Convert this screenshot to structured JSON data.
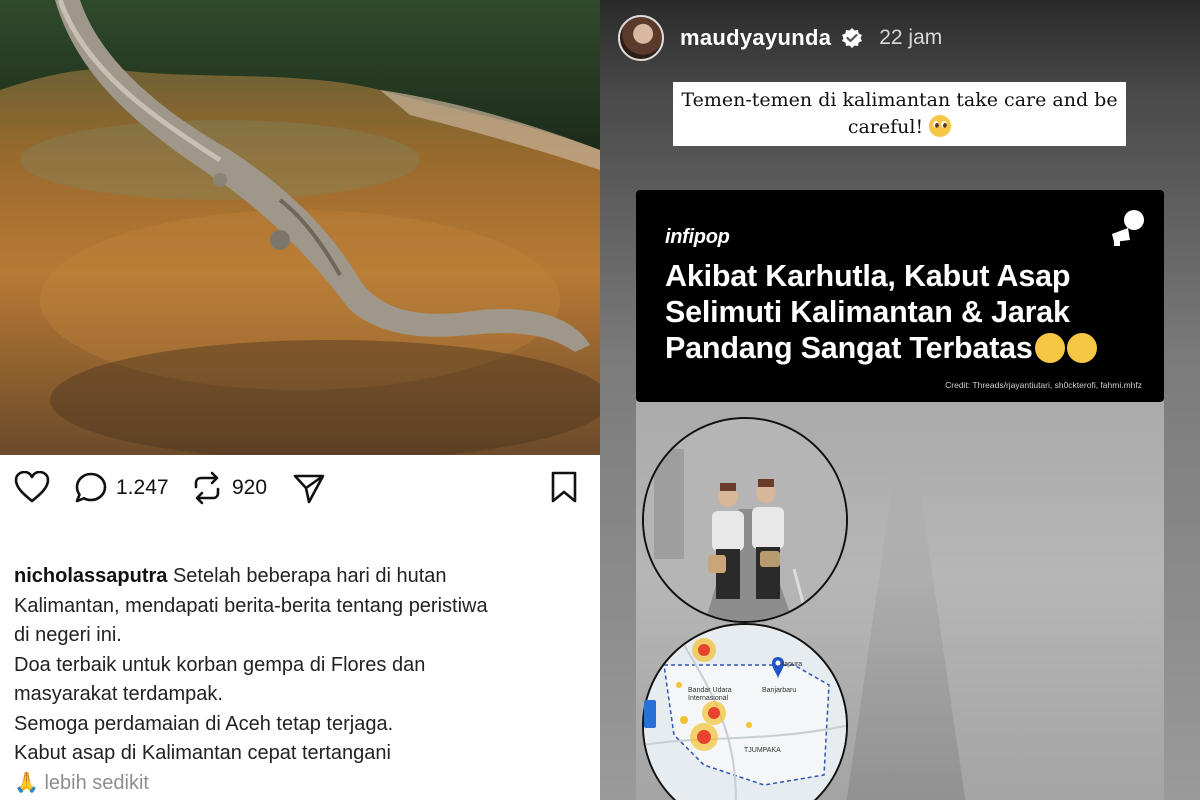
{
  "left_post": {
    "actions": {
      "like_icon": "heart-icon",
      "comment_icon": "comment-icon",
      "comment_count": "1.247",
      "repost_icon": "repost-icon",
      "repost_count": "920",
      "share_icon": "send-icon",
      "save_icon": "bookmark-icon"
    },
    "caption": {
      "username": "nicholassaputra",
      "lines": [
        " Setelah beberapa hari di hutan",
        "Kalimantan, mendapati berita-berita tentang peristiwa",
        "di negeri ini.",
        "Doa terbaik untuk korban gempa di Flores dan",
        "masyarakat terdampak.",
        "Semoga perdamaian di Aceh tetap terjaga.",
        "Kabut asap di Kalimantan cepat tertangani"
      ],
      "more_emoji": "🙏",
      "more_label": "lebih sedikit"
    }
  },
  "story": {
    "username": "maudyayunda",
    "time": "22 jam",
    "quote": "Temen-temen di kalimantan take care and be careful!",
    "card": {
      "brand": "infipop",
      "headline": "Akibat Karhutla, Kabut Asap Selimuti Kalimantan & Jarak Pandang Sangat Terbatas",
      "credit": "Credit: Threads/rjayantiutari, sh0ckterofi, fahmi.mhfz"
    },
    "map_labels": {
      "city1": "rtapura",
      "city2": "Banjarbaru",
      "airport": "Bandar Udara Internasional",
      "area": "TJUMPAKA"
    }
  },
  "colors": {
    "heat_red": "#e8432e",
    "heat_yellow": "#f2c230",
    "map_pin": "#1f55c8"
  }
}
